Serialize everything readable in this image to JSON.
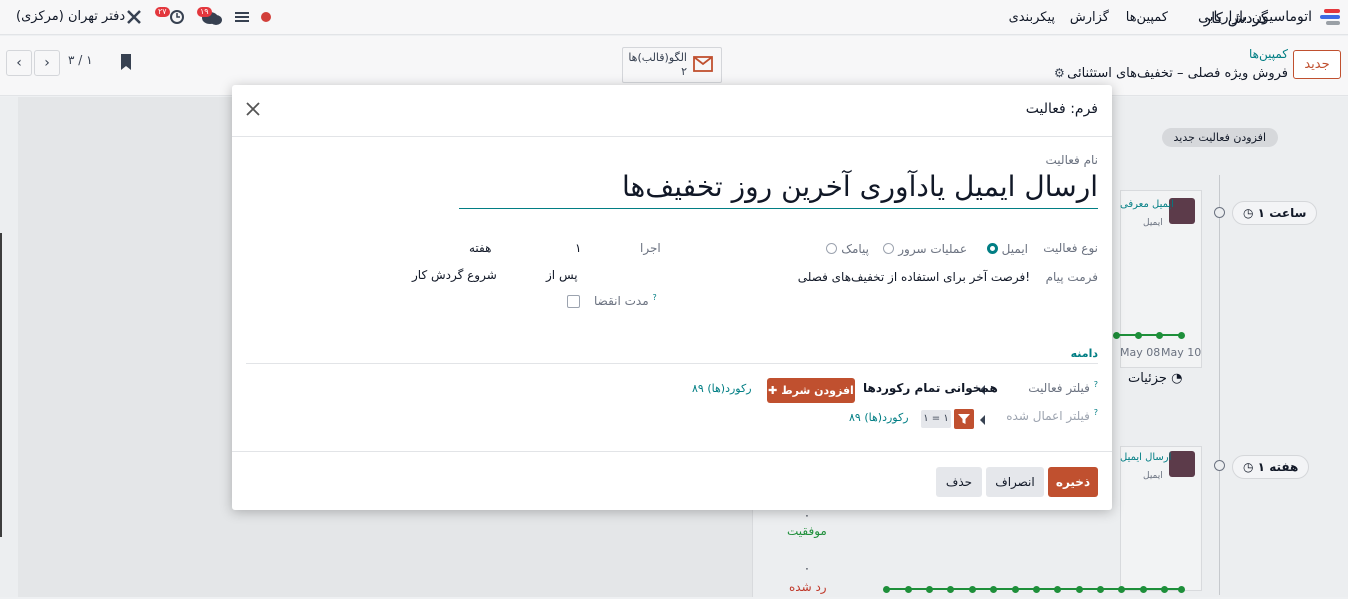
{
  "navbar": {
    "app_title": "اتوماسیون بازاریابی",
    "menu": [
      "کمپین‌ها",
      "گزارش",
      "پیکربندی"
    ],
    "messages_badge": "۱۹",
    "activities_badge": "۲۷",
    "company": "دفتر تهران (مرکزی)"
  },
  "control": {
    "new_label": "جدید",
    "breadcrumb_parent": "کمپین‌ها",
    "breadcrumb_current": "فروش ویژه فصلی – تخفیف‌های استثنائی",
    "stat_label": "الگو(قالب)ها",
    "stat_value": "۲",
    "pager": "۳ / ۱"
  },
  "workflow": {
    "title": "گردش کار",
    "add_activity": "افزودن فعالیت جدید",
    "step1_interval": "۱ ساعت",
    "step2_interval": "۱ هفته",
    "card1_label": "ایمیل معرفی",
    "card1_sub": "ایمیل",
    "card2_label": "ارسال ایمیل",
    "card2_sub": "ایمیل",
    "date_a": "May 08",
    "date_b": "May 10",
    "details": "جزئیات",
    "success_count": "۰",
    "success_label": "موفقیت",
    "rejected_count": "۰",
    "rejected_label": "رد شده"
  },
  "modal": {
    "title": "فرم: فعالیت",
    "name_label": "نام فعالیت",
    "name_value": "ارسال ایمیل یادآوری آخرین روز تخفیف‌ها",
    "type_label": "نوع فعالیت",
    "type_options": [
      "ایمیل",
      "عملیات سرور",
      "پیامک"
    ],
    "format_label": "فرمت پیام",
    "format_value": "فرصت آخر برای استفاده از تخفیف‌های فصلی!",
    "execute_label": "اجرا",
    "execute_value": "۱",
    "execute_unit": "هفته",
    "after_label": "پس از",
    "trigger_value": "شروع گردش کار",
    "expiry_label": "مدت انقضا",
    "domain_section": "دامنه",
    "activity_filter_label": "فیلتر فعالیت",
    "match_all": "همخوانی تمام رکوردها",
    "add_condition": "افزودن شرط",
    "records_1": "۸۹ رکورد(ها)",
    "applied_filter_label": "فیلتر اعمال شده",
    "filter_tag": "۱ = ۱",
    "records_2": "۸۹ رکورد(ها)",
    "save": "ذخیره",
    "discard": "انصراف",
    "delete": "حذف"
  },
  "colors": {
    "primary": "#c0502f",
    "link": "#017e84",
    "success": "#1e8f3a",
    "danger": "#c0392b"
  }
}
